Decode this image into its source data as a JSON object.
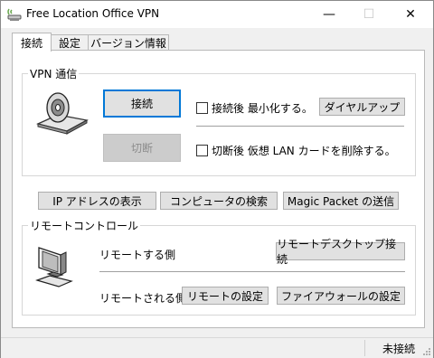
{
  "window": {
    "title": "Free Location Office VPN",
    "min_glyph": "—",
    "max_glyph": "☐",
    "close_glyph": "✕"
  },
  "tabs": [
    {
      "label": "接続",
      "active": true
    },
    {
      "label": "設定",
      "active": false
    },
    {
      "label": "バージョン情報",
      "active": false
    }
  ],
  "vpn_group": {
    "title": "VPN 通信",
    "connect_label": "接続",
    "disconnect_label": "切断",
    "minimize_after_connect": "接続後 最小化する。",
    "dialup_label": "ダイヤルアップ",
    "delete_lan_card": "切断後 仮想 LAN カードを削除する。"
  },
  "actions": {
    "ip_address": "IP アドレスの表示",
    "computer_search": "コンピュータの検索",
    "magic_packet": "Magic Packet の送信"
  },
  "remote_group": {
    "title": "リモートコントロール",
    "controller_side": "リモートする側",
    "remote_desktop": "リモートデスクトップ接続",
    "controlled_side": "リモートされる側",
    "remote_settings": "リモートの設定",
    "firewall_settings": "ファイアウォールの設定"
  },
  "status": {
    "text": "未接続"
  }
}
